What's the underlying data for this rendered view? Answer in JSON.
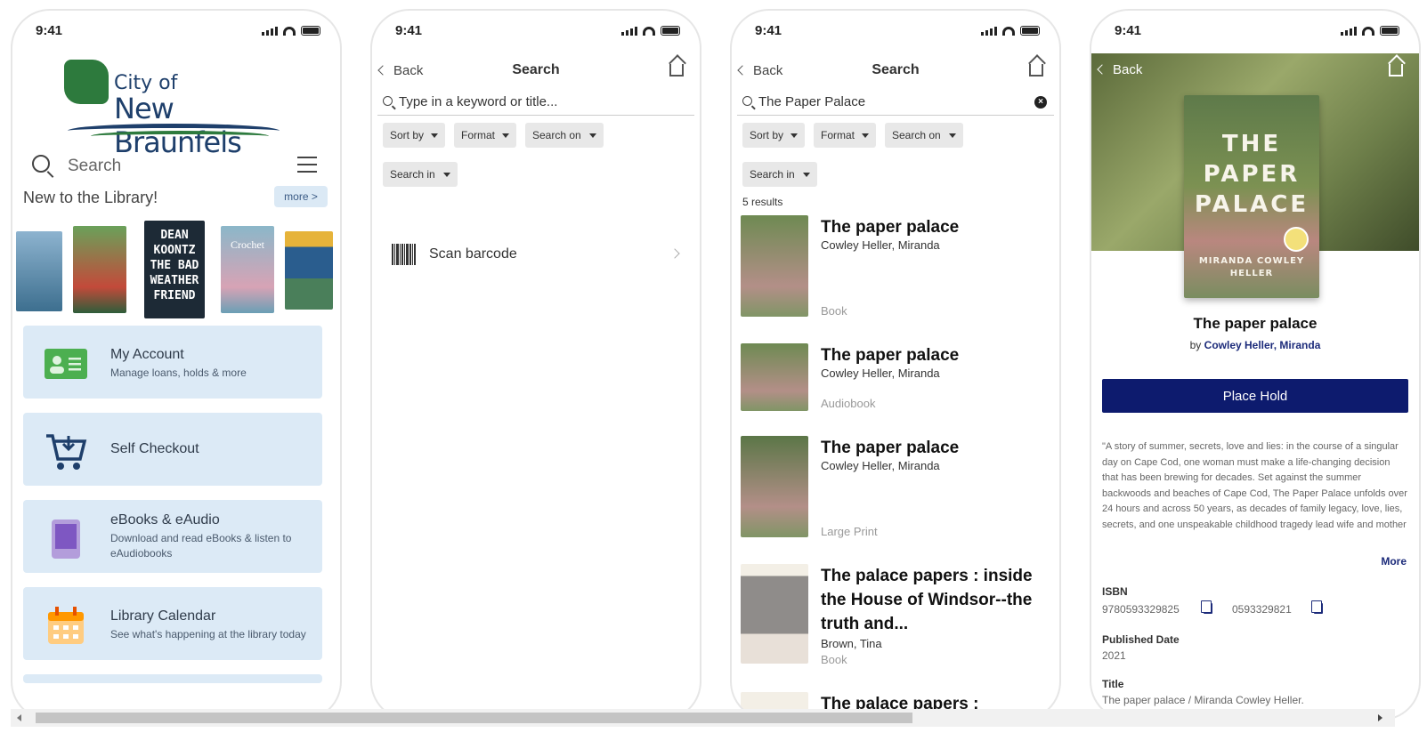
{
  "status": {
    "time": "9:41"
  },
  "phone1": {
    "logo_small": "City of",
    "logo_big": "New Braunfels",
    "search_placeholder": "Search",
    "section_title": "New to the Library!",
    "more_label": "more >",
    "covers": [
      {
        "text": "",
        "color": "#5a8fb0"
      },
      {
        "text": "",
        "color": "#3c6a47"
      },
      {
        "text": "DEAN KOONTZ THE BAD WEATHER FRIEND",
        "color": "#1d2a36"
      },
      {
        "text": "Crochet",
        "color": "#8bb7c9"
      },
      {
        "text": "",
        "color": "#2a5d8e"
      }
    ],
    "menu": [
      {
        "title": "My Account",
        "subtitle": "Manage loans, holds & more",
        "icon": "id-card-icon"
      },
      {
        "title": "Self Checkout",
        "subtitle": "",
        "icon": "cart-icon"
      },
      {
        "title": "eBooks & eAudio",
        "subtitle": "Download and read eBooks & listen to eAudiobooks",
        "icon": "tablet-icon"
      },
      {
        "title": "Library Calendar",
        "subtitle": "See what's happening at the library today",
        "icon": "calendar-icon"
      }
    ]
  },
  "phone2": {
    "back_label": "Back",
    "title": "Search",
    "search_placeholder": "Type in a keyword or title...",
    "chips": [
      "Sort by",
      "Format",
      "Search on",
      "Search in"
    ],
    "scan_label": "Scan barcode"
  },
  "phone3": {
    "back_label": "Back",
    "title": "Search",
    "search_value": "The Paper Palace",
    "chips": [
      "Sort by",
      "Format",
      "Search on",
      "Search in"
    ],
    "results_count": "5 results",
    "results": [
      {
        "title": "The paper palace",
        "author": "Cowley Heller, Miranda",
        "format": "Book"
      },
      {
        "title": "The paper palace",
        "author": "Cowley Heller, Miranda",
        "format": "Audiobook"
      },
      {
        "title": "The paper palace",
        "author": "Cowley Heller, Miranda",
        "format": "Large Print"
      },
      {
        "title": "The palace papers : inside the House of Windsor--the truth and...",
        "author": "Brown, Tina",
        "format": "Book"
      },
      {
        "title": "The palace papers :",
        "author": "",
        "format": ""
      }
    ]
  },
  "phone4": {
    "back_label": "Back",
    "cover_text": [
      "THE",
      "PAPER",
      "PALACE"
    ],
    "cover_author": "MIRANDA COWLEY HELLER",
    "title": "The paper palace",
    "by_label": "by",
    "author": "Cowley Heller, Miranda",
    "place_hold_label": "Place Hold",
    "description": "\"A story of summer, secrets, love and lies: in the course of a singular day on Cape Cod, one woman must make a life-changing decision that has been brewing for decades. Set against the summer backwoods and beaches of Cape Cod, The Paper Palace unfolds over 24 hours and across 50 years, as decades of family legacy, love, lies, secrets, and one unspeakable childhood tragedy lead wife and mother",
    "more_label": "More",
    "isbn_label": "ISBN",
    "isbn_1": "9780593329825",
    "isbn_2": "0593329821",
    "published_label": "Published Date",
    "published_value": "2021",
    "title_label": "Title",
    "title_value": "The paper palace / Miranda Cowley Heller."
  }
}
